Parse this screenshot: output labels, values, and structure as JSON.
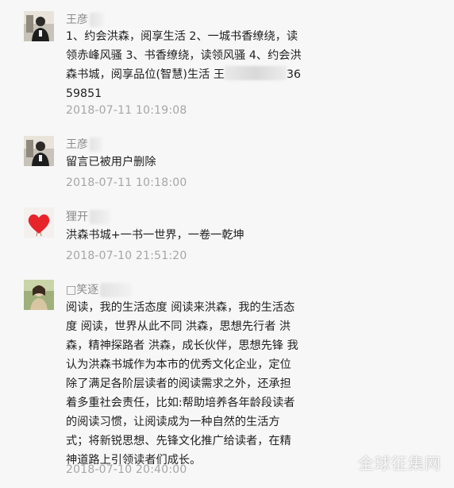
{
  "comments": [
    {
      "avatar_icon": "person-photo-avatar",
      "name": "王彦",
      "content_part1": "1、约会洪森，阅享生活 2、一城书香缭绕，读领赤峰风骚 3、书香缭绕，读领风骚 4、约会洪森书城，阅享品位(智慧)生活 王",
      "content_part2": "3659851",
      "time": "2018-07-11 10:19:08"
    },
    {
      "avatar_icon": "person-photo-avatar",
      "name": "王彦",
      "content": "留言已被用户删除",
      "time": "2018-07-11 10:18:00"
    },
    {
      "avatar_icon": "heart-avatar",
      "name": "狸开",
      "content": "洪森书城+一书一世界，一卷一乾坤",
      "time": "2018-07-10 21:51:20"
    },
    {
      "avatar_icon": "portrait-avatar",
      "name": "□笑逐",
      "content": "阅读，我的生活态度 阅读来洪森，我的生活态度 阅读，世界从此不同 洪森，思想先行者 洪森，精神探路者 洪森，成长伙伴，思想先锋 我认为洪森书城作为本市的优秀文化企业，定位除了满足各阶层读者的阅读需求之外，还承担着多重社会责任，比如:帮助培养各年龄段读者的阅读习惯，让阅读成为一种自然的生活方式；将新锐思想、先锋文化推广给读者，在精神道路上引领读者们成长。",
      "time": "2018-07-10 20:40:00"
    }
  ],
  "watermark": "全球征集网"
}
